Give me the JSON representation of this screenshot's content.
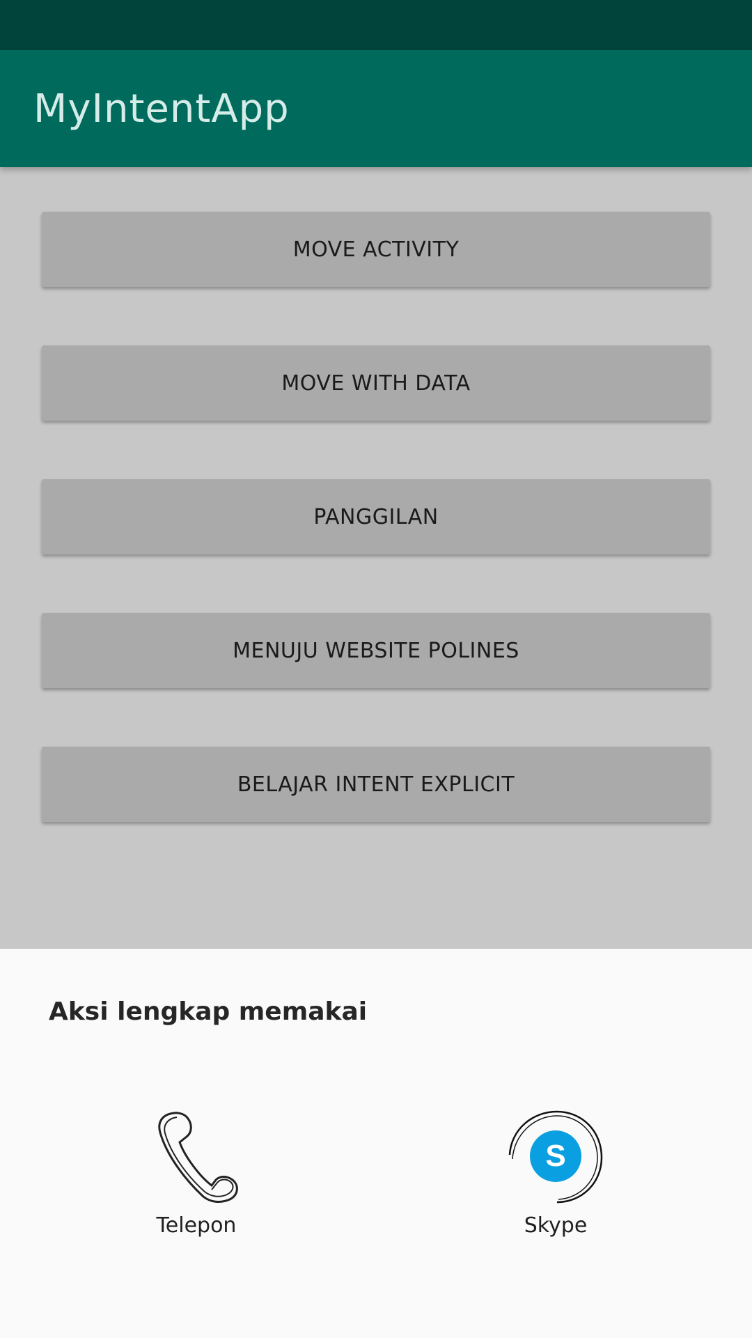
{
  "app": {
    "title": "MyIntentApp"
  },
  "buttons": [
    {
      "label": "MOVE ACTIVITY"
    },
    {
      "label": "MOVE WITH DATA"
    },
    {
      "label": "PANGGILAN"
    },
    {
      "label": "MENUJU WEBSITE POLINES"
    },
    {
      "label": "BELAJAR INTENT EXPLICIT"
    }
  ],
  "chooser": {
    "title": "Aksi lengkap memakai",
    "options": [
      {
        "label": "Telepon",
        "icon": "phone-icon"
      },
      {
        "label": "Skype",
        "icon": "skype-icon"
      }
    ]
  },
  "colors": {
    "status_bar": "#00443b",
    "app_bar": "#006b5d",
    "button": "#a9aaa9",
    "skype_blue": "#0a9fe0"
  }
}
